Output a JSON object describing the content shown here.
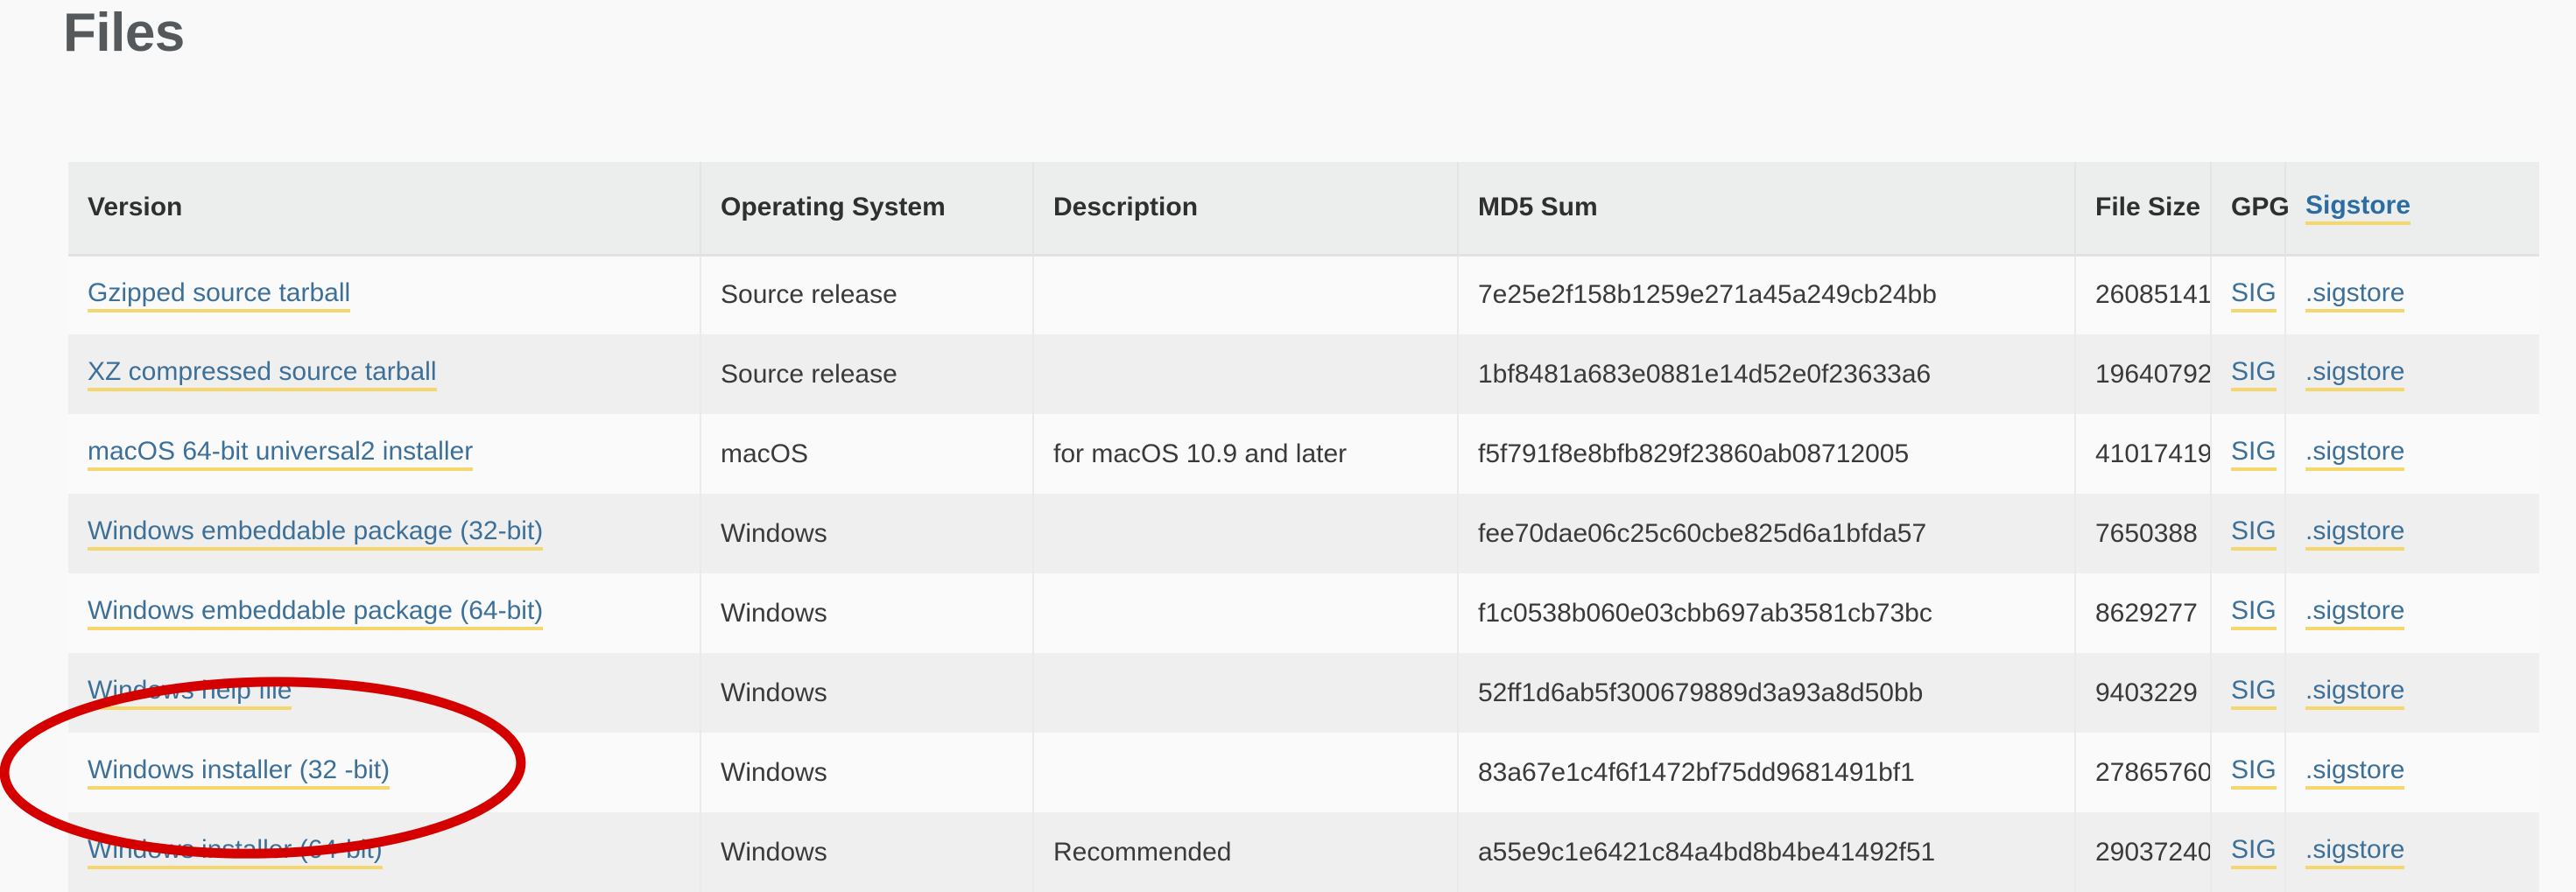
{
  "page": {
    "title": "Files",
    "background_color": "#f9f9f9",
    "link_color": "#3d7099",
    "link_underline_color": "#f5d76e",
    "annotation_color": "#d40000"
  },
  "table": {
    "headers": {
      "version": "Version",
      "operating_system": "Operating System",
      "description": "Description",
      "md5_sum": "MD5 Sum",
      "file_size": "File Size",
      "gpg": "GPG",
      "sigstore": "Sigstore"
    },
    "rows": [
      {
        "version": "Gzipped source tarball",
        "operating_system": "Source release",
        "description": "",
        "md5": "7e25e2f158b1259e271a45a249cb24bb",
        "size": "26085141",
        "gpg": "SIG",
        "sigstore": ".sigstore"
      },
      {
        "version": "XZ compressed source tarball",
        "operating_system": "Source release",
        "description": "",
        "md5": "1bf8481a683e0881e14d52e0f23633a6",
        "size": "19640792",
        "gpg": "SIG",
        "sigstore": ".sigstore"
      },
      {
        "version": "macOS 64-bit universal2 installer",
        "operating_system": "macOS",
        "description": "for macOS 10.9 and later",
        "md5": "f5f791f8e8bfb829f23860ab08712005",
        "size": "41017419",
        "gpg": "SIG",
        "sigstore": ".sigstore"
      },
      {
        "version": "Windows embeddable package (32-bit)",
        "operating_system": "Windows",
        "description": "",
        "md5": "fee70dae06c25c60cbe825d6a1bfda57",
        "size": "7650388",
        "gpg": "SIG",
        "sigstore": ".sigstore"
      },
      {
        "version": "Windows embeddable package (64-bit)",
        "operating_system": "Windows",
        "description": "",
        "md5": "f1c0538b060e03cbb697ab3581cb73bc",
        "size": "8629277",
        "gpg": "SIG",
        "sigstore": ".sigstore"
      },
      {
        "version": "Windows help file",
        "operating_system": "Windows",
        "description": "",
        "md5": "52ff1d6ab5f300679889d3a93a8d50bb",
        "size": "9403229",
        "gpg": "SIG",
        "sigstore": ".sigstore"
      },
      {
        "version": "Windows installer (32 -bit)",
        "operating_system": "Windows",
        "description": "",
        "md5": "83a67e1c4f6f1472bf75dd9681491bf1",
        "size": "27865760",
        "gpg": "SIG",
        "sigstore": ".sigstore"
      },
      {
        "version": "Windows installer (64-bit)",
        "operating_system": "Windows",
        "description": "Recommended",
        "md5": "a55e9c1e6421c84a4bd8b4be41492f51",
        "size": "29037240",
        "gpg": "SIG",
        "sigstore": ".sigstore"
      }
    ]
  }
}
